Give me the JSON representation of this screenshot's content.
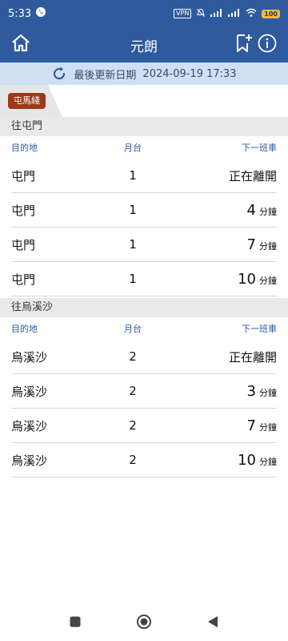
{
  "status_bar": {
    "time": "5:33",
    "vpn": "VPN",
    "battery": "100"
  },
  "app_bar": {
    "title": "元朗"
  },
  "update": {
    "label": "最後更新日期",
    "datetime": "2024-09-19 17:33"
  },
  "tab": {
    "label": "屯馬綫"
  },
  "columns": {
    "destination": "目的地",
    "platform": "月台",
    "next_train": "下一班車"
  },
  "sections": [
    {
      "title": "往屯門",
      "rows": [
        {
          "dest": "屯門",
          "platform": "1",
          "status": "正在離開",
          "minutes": "",
          "unit": ""
        },
        {
          "dest": "屯門",
          "platform": "1",
          "status": "",
          "minutes": "4",
          "unit": "分鐘"
        },
        {
          "dest": "屯門",
          "platform": "1",
          "status": "",
          "minutes": "7",
          "unit": "分鐘"
        },
        {
          "dest": "屯門",
          "platform": "1",
          "status": "",
          "minutes": "10",
          "unit": "分鐘"
        }
      ]
    },
    {
      "title": "往烏溪沙",
      "rows": [
        {
          "dest": "烏溪沙",
          "platform": "2",
          "status": "正在離開",
          "minutes": "",
          "unit": ""
        },
        {
          "dest": "烏溪沙",
          "platform": "2",
          "status": "",
          "minutes": "3",
          "unit": "分鐘"
        },
        {
          "dest": "烏溪沙",
          "platform": "2",
          "status": "",
          "minutes": "7",
          "unit": "分鐘"
        },
        {
          "dest": "烏溪沙",
          "platform": "2",
          "status": "",
          "minutes": "10",
          "unit": "分鐘"
        }
      ]
    }
  ],
  "icons": {
    "home": "home-icon",
    "bookmark_add": "bookmark-add-icon",
    "info": "info-icon",
    "refresh": "refresh-icon"
  },
  "colors": {
    "primary": "#2f5a9e",
    "banner": "#cfe0f5",
    "line_badge": "#9c3a17",
    "column_header": "#2b5aa0"
  }
}
